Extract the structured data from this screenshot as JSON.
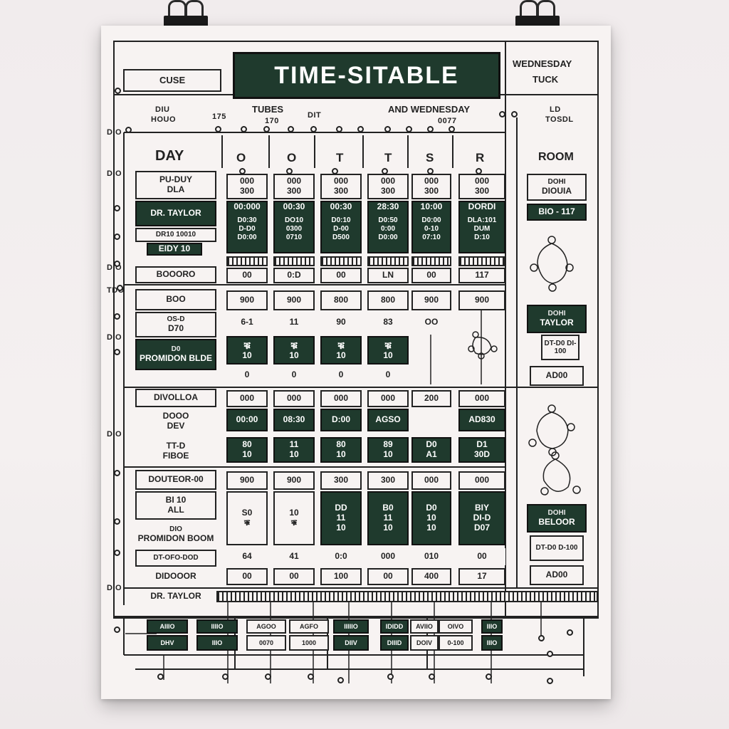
{
  "header": {
    "title": "TIME-SITABLE",
    "top_left_label": "CUSE",
    "top_right_line1": "WEDNESDAY",
    "top_right_line2": "TUCK",
    "sub_labels": [
      "DIU",
      "HOUO",
      "175",
      "TUBES",
      "170",
      "DIT",
      "AND WEDNESDAY",
      "0077",
      "LD",
      "TOSDL"
    ]
  },
  "columns": {
    "day_label": "DAY",
    "letters": [
      "O",
      "O",
      "T",
      "T",
      "S",
      "R"
    ],
    "room_label": "ROOM"
  },
  "row_labels": {
    "r1": [
      "PU-DUY",
      "DLA"
    ],
    "teacher_top": "DR. TAYLOR",
    "r2a": "DR10 10010",
    "r2b": "EIDY 10",
    "r2c": "BOOORO",
    "r3": "BOO",
    "r4": [
      "OS-D",
      "D70"
    ],
    "r5": [
      "D0",
      "PROMIDON BLDE"
    ],
    "r6": "DIVOLLOA",
    "r7": [
      "DOOO",
      "DEV"
    ],
    "r8": [
      "TT-D",
      "FIBOE"
    ],
    "r9": "DOUTEOR-00",
    "r10": [
      "BI 10",
      "ALL"
    ],
    "r11": [
      "DIO",
      "PROMIDON BOOM"
    ],
    "r12": "DT-OFO-DOD",
    "r13": "DIDOOOR",
    "teacher_bottom": "DR. TAYLOR"
  },
  "grid": {
    "block1_top": [
      [
        "000",
        "300"
      ],
      [
        "000",
        "300"
      ],
      [
        "000",
        "300"
      ],
      [
        "000",
        "300"
      ],
      [
        "000",
        "300"
      ],
      [
        "000",
        "300"
      ]
    ],
    "block1_times": [
      "00:000",
      "00:30",
      "00:30",
      "28:30",
      "10:00",
      "DORDI"
    ],
    "block1_details": [
      [
        "D0:30",
        "D-D0",
        "D0:00"
      ],
      [
        "DO10",
        "0300",
        "0710"
      ],
      [
        "D0:10",
        "D-00",
        "D500"
      ],
      [
        "D0:50",
        "0:00",
        "D0:00"
      ],
      [
        "D0:00",
        "0-10",
        "07:10"
      ],
      [
        "DLA:101",
        "DUM",
        "D:10"
      ]
    ],
    "block1_bottom": [
      "00",
      "0:D",
      "00",
      "LN",
      "00",
      "117"
    ],
    "block2_top": [
      "900",
      "900",
      "800",
      "800",
      "900",
      "900"
    ],
    "block2_mid": [
      "6-1",
      "11",
      "90",
      "83",
      "OO",
      ""
    ],
    "block2_icons": [
      "ቑ",
      "ቑ",
      "ቑ",
      "ቑ",
      "",
      ""
    ],
    "block2_icon_sub": [
      "10",
      "10",
      "10",
      "10",
      "",
      ""
    ],
    "block2_bottom": [
      "0",
      "0",
      "0",
      "0",
      "",
      ""
    ],
    "block3_top": [
      "000",
      "000",
      "000",
      "000",
      "200",
      "000"
    ],
    "block3_times": [
      "00:00",
      "08:30",
      "D:00",
      "AGSO",
      "",
      "AD830"
    ],
    "block3_nums": [
      [
        "80",
        "10"
      ],
      [
        "11",
        "10"
      ],
      [
        "80",
        "10"
      ],
      [
        "89",
        "10"
      ],
      [
        "D0",
        "A1"
      ],
      [
        "D1",
        "30D"
      ]
    ],
    "block4_top": [
      "900",
      "900",
      "300",
      "300",
      "000",
      "000"
    ],
    "block4_mid": [
      "S0",
      "10",
      "DD",
      "B0",
      "D0",
      "BIY"
    ],
    "block4_sub": [
      "",
      "",
      "11",
      "11",
      "10",
      "DI-D"
    ],
    "block4_icons": [
      "ቑ",
      "ቑ",
      "10",
      "10",
      "10",
      "D07"
    ],
    "block4_bottom": [
      "64",
      "41",
      "0:0",
      "000",
      "010",
      "00"
    ],
    "block4_final": [
      "00",
      "00",
      "100",
      "00",
      "400",
      "17"
    ]
  },
  "room_panel": {
    "box1": [
      "DOHI",
      "DIOUIA"
    ],
    "box2": "BIO - 117",
    "box3": [
      "DOHI",
      "TAYLOR"
    ],
    "box3_sub": "DT-D0 DI-100",
    "box4": "AD00",
    "box5": [
      "DOHI",
      "BELOOR"
    ],
    "box5_sub": "DT-D0 D-100",
    "box6": "AD00"
  },
  "footer": {
    "cells": [
      [
        "AIIIO",
        "DHV"
      ],
      [
        "IIIIO",
        "IIIO"
      ],
      [
        "AGOO",
        "0070"
      ],
      [
        "AGFO",
        "1000"
      ],
      [
        "IIIIIO",
        "DIIV"
      ],
      [
        "IDIDD",
        "DIIID"
      ],
      [
        "AVIIO",
        "DOIV"
      ],
      [
        "OIVO",
        "0-100"
      ],
      [
        "IIIO",
        "IIIO"
      ]
    ]
  },
  "side_labels": [
    "DIO",
    "DIO",
    "DIO",
    "TDO",
    "DIO",
    "DIO",
    "DIO"
  ]
}
